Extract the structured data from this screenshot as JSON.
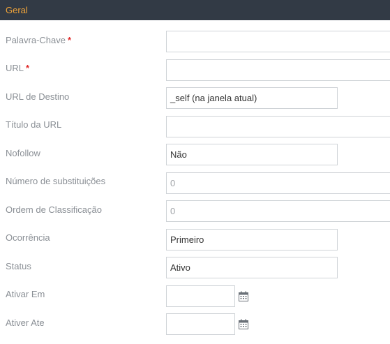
{
  "section": {
    "title": "Geral"
  },
  "form": {
    "keyword": {
      "label": "Palavra-Chave",
      "required_mark": "*",
      "value": ""
    },
    "url": {
      "label": "URL",
      "required_mark": "*",
      "value": ""
    },
    "target": {
      "label": "URL de Destino",
      "value": "_self (na janela atual)"
    },
    "url_title": {
      "label": "Título da URL",
      "value": ""
    },
    "nofollow": {
      "label": "Nofollow",
      "value": "Não"
    },
    "replacements": {
      "label": "Número de substituições",
      "placeholder": "0"
    },
    "sort_order": {
      "label": "Ordem de Classificação",
      "placeholder": "0"
    },
    "occurrence": {
      "label": "Ocorrência",
      "value": "Primeiro"
    },
    "status": {
      "label": "Status",
      "value": "Ativo"
    },
    "active_from": {
      "label": "Ativar Em",
      "value": "",
      "icon": "calendar-icon"
    },
    "active_to": {
      "label": "Ativer Ate",
      "value": "",
      "icon": "calendar-icon"
    }
  },
  "colors": {
    "header_bg": "#323a45",
    "header_text": "#f0a43a",
    "label_text": "#8a8f95",
    "required": "#e02828",
    "border": "#cfd3d7"
  }
}
